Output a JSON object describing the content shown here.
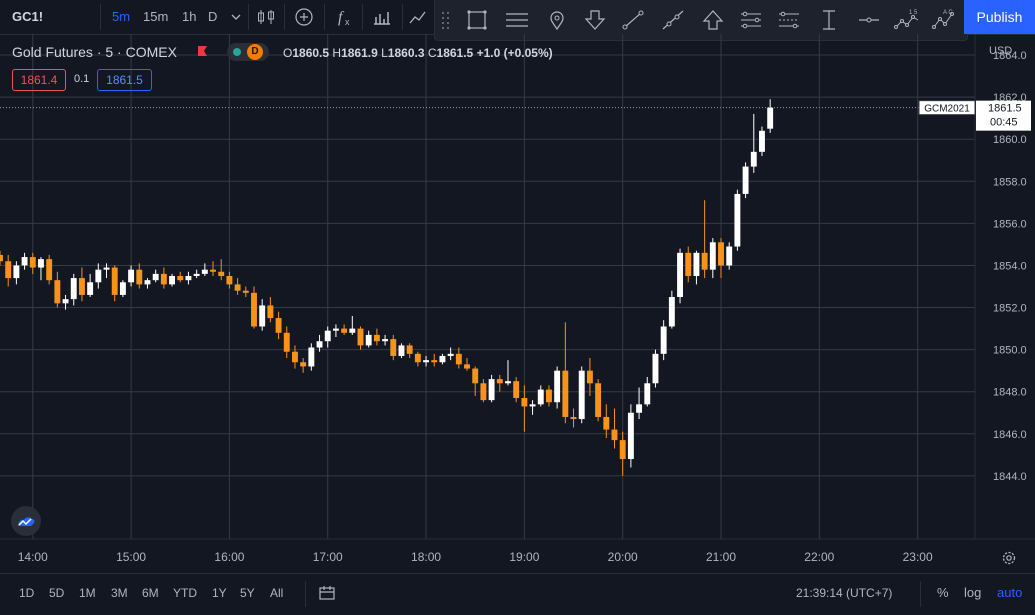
{
  "toolbar": {
    "symbol": "GC1!",
    "intervals": [
      "5m",
      "15m",
      "1h",
      "D"
    ],
    "active_interval": "5m",
    "publish_label": "Publish",
    "icons": [
      "chevron-down-icon",
      "candles-icon",
      "add-compare-icon",
      "indicators-icon",
      "financials-icon"
    ],
    "drawing_icons": [
      "rectangle-icon",
      "horizontal-lines-icon",
      "pin-icon",
      "arrow-down-icon",
      "trend-line-icon",
      "ray-icon",
      "arrow-up-icon",
      "parallel-channel-icon",
      "regression-icon",
      "price-range-icon",
      "horizontal-ray-icon",
      "xabcd-pattern-icon",
      "abcd-pattern-icon"
    ]
  },
  "legend": {
    "title": "Gold Futures · 5 · COMEX",
    "badge_d": "D",
    "open_label": "O",
    "open": "1860.5",
    "high_label": "H",
    "high": "1861.9",
    "low_label": "L",
    "low": "1860.3",
    "close_label": "C",
    "close": "1861.5",
    "change": "+1.0 (+0.05%)",
    "bid": "1861.4",
    "spread": "0.1",
    "ask": "1861.5"
  },
  "price_scale": {
    "contract_label": "GCM2021",
    "last_price": "1861.5",
    "countdown": "00:45",
    "currency": "USD"
  },
  "bottom": {
    "ranges": [
      "1D",
      "5D",
      "1M",
      "3M",
      "6M",
      "YTD",
      "1Y",
      "5Y",
      "All"
    ],
    "clock": "21:39:14 (UTC+7)",
    "percent_label": "%",
    "log_label": "log",
    "auto_label": "auto"
  },
  "colors": {
    "up": "#ffffff",
    "down": "#f7931a",
    "background": "#131722",
    "grid": "#363a45",
    "accent": "#2962ff"
  },
  "chart_data": {
    "type": "candlestick",
    "title": "Gold Futures · 5 · COMEX",
    "xlabel": "",
    "ylabel": "",
    "x_ticks": [
      "14:00",
      "15:00",
      "16:00",
      "17:00",
      "18:00",
      "19:00",
      "20:00",
      "21:00",
      "22:00",
      "23:00"
    ],
    "y_ticks": [
      1844.0,
      1846.0,
      1848.0,
      1850.0,
      1852.0,
      1854.0,
      1856.0,
      1858.0,
      1860.0,
      1862.0,
      1864.0
    ],
    "ylim": [
      1841.0,
      1865.0
    ],
    "xlim": [
      "13:40",
      "23:35"
    ],
    "interval_minutes": 5,
    "first_bar": "13:40",
    "grid": true,
    "last_price_line": 1861.5,
    "ohlc": [
      [
        1854.5,
        1854.7,
        1854.0,
        1854.2
      ],
      [
        1854.2,
        1854.5,
        1853.0,
        1853.4
      ],
      [
        1853.4,
        1854.2,
        1853.1,
        1854.0
      ],
      [
        1854.0,
        1854.6,
        1853.8,
        1854.4
      ],
      [
        1854.4,
        1854.6,
        1853.6,
        1853.9
      ],
      [
        1853.9,
        1854.4,
        1853.3,
        1854.3
      ],
      [
        1854.3,
        1854.5,
        1853.1,
        1853.3
      ],
      [
        1853.3,
        1853.7,
        1852.0,
        1852.2
      ],
      [
        1852.2,
        1852.6,
        1851.9,
        1852.4
      ],
      [
        1852.4,
        1853.6,
        1852.1,
        1853.4
      ],
      [
        1853.4,
        1853.9,
        1852.3,
        1852.6
      ],
      [
        1852.6,
        1853.6,
        1852.5,
        1853.2
      ],
      [
        1853.2,
        1854.1,
        1852.9,
        1853.8
      ],
      [
        1853.8,
        1854.1,
        1853.4,
        1853.9
      ],
      [
        1853.9,
        1854.0,
        1852.3,
        1852.6
      ],
      [
        1852.6,
        1853.3,
        1852.5,
        1853.2
      ],
      [
        1853.2,
        1854.0,
        1853.0,
        1853.8
      ],
      [
        1853.8,
        1854.1,
        1852.9,
        1853.1
      ],
      [
        1853.1,
        1853.4,
        1852.9,
        1853.3
      ],
      [
        1853.3,
        1853.8,
        1853.2,
        1853.6
      ],
      [
        1853.6,
        1853.9,
        1852.9,
        1853.1
      ],
      [
        1853.1,
        1853.6,
        1853.0,
        1853.5
      ],
      [
        1853.5,
        1853.7,
        1853.2,
        1853.3
      ],
      [
        1853.3,
        1853.7,
        1853.1,
        1853.5
      ],
      [
        1853.5,
        1853.8,
        1853.4,
        1853.6
      ],
      [
        1853.6,
        1854.1,
        1853.5,
        1853.8
      ],
      [
        1853.8,
        1854.2,
        1853.5,
        1853.7
      ],
      [
        1853.7,
        1854.3,
        1853.3,
        1853.5
      ],
      [
        1853.5,
        1853.7,
        1852.9,
        1853.1
      ],
      [
        1853.1,
        1853.4,
        1852.6,
        1852.8
      ],
      [
        1852.8,
        1853.0,
        1852.5,
        1852.7
      ],
      [
        1852.7,
        1853.0,
        1851.0,
        1851.1
      ],
      [
        1851.1,
        1852.4,
        1850.9,
        1852.1
      ],
      [
        1852.1,
        1852.5,
        1851.3,
        1851.5
      ],
      [
        1851.5,
        1851.8,
        1850.5,
        1850.8
      ],
      [
        1850.8,
        1851.1,
        1849.6,
        1849.9
      ],
      [
        1849.9,
        1850.2,
        1849.1,
        1849.4
      ],
      [
        1849.4,
        1849.6,
        1848.9,
        1849.2
      ],
      [
        1849.2,
        1850.3,
        1849.0,
        1850.1
      ],
      [
        1850.1,
        1850.7,
        1849.9,
        1850.4
      ],
      [
        1850.4,
        1851.1,
        1850.1,
        1850.9
      ],
      [
        1850.9,
        1851.2,
        1850.6,
        1851.0
      ],
      [
        1851.0,
        1851.2,
        1850.7,
        1850.8
      ],
      [
        1850.8,
        1851.6,
        1850.7,
        1851.0
      ],
      [
        1851.0,
        1851.1,
        1850.0,
        1850.2
      ],
      [
        1850.2,
        1850.9,
        1850.1,
        1850.7
      ],
      [
        1850.7,
        1851.0,
        1850.2,
        1850.4
      ],
      [
        1850.4,
        1850.7,
        1850.2,
        1850.5
      ],
      [
        1850.5,
        1850.7,
        1849.5,
        1849.7
      ],
      [
        1849.7,
        1850.3,
        1849.6,
        1850.2
      ],
      [
        1850.2,
        1850.3,
        1849.6,
        1849.8
      ],
      [
        1849.8,
        1849.9,
        1849.2,
        1849.4
      ],
      [
        1849.4,
        1849.7,
        1849.2,
        1849.5
      ],
      [
        1849.5,
        1849.8,
        1849.2,
        1849.4
      ],
      [
        1849.4,
        1849.8,
        1849.3,
        1849.7
      ],
      [
        1849.7,
        1850.1,
        1849.5,
        1849.8
      ],
      [
        1849.8,
        1850.1,
        1849.1,
        1849.3
      ],
      [
        1849.3,
        1849.6,
        1849.0,
        1849.1
      ],
      [
        1849.1,
        1849.2,
        1847.8,
        1848.4
      ],
      [
        1848.4,
        1848.6,
        1847.5,
        1847.6
      ],
      [
        1847.6,
        1848.8,
        1847.5,
        1848.6
      ],
      [
        1848.6,
        1848.8,
        1848.0,
        1848.4
      ],
      [
        1848.4,
        1849.5,
        1848.3,
        1848.5
      ],
      [
        1848.5,
        1848.7,
        1847.5,
        1847.7
      ],
      [
        1847.7,
        1848.3,
        1846.1,
        1847.3
      ],
      [
        1847.3,
        1847.6,
        1846.9,
        1847.4
      ],
      [
        1847.4,
        1848.3,
        1847.3,
        1848.1
      ],
      [
        1848.1,
        1848.3,
        1847.3,
        1847.5
      ],
      [
        1847.5,
        1849.2,
        1847.2,
        1849.0
      ],
      [
        1849.0,
        1851.3,
        1846.5,
        1846.8
      ],
      [
        1846.8,
        1847.2,
        1846.3,
        1846.7
      ],
      [
        1846.7,
        1849.2,
        1846.5,
        1849.0
      ],
      [
        1849.0,
        1849.6,
        1847.8,
        1848.4
      ],
      [
        1848.4,
        1848.6,
        1846.6,
        1846.8
      ],
      [
        1846.8,
        1847.4,
        1845.8,
        1846.2
      ],
      [
        1846.2,
        1847.2,
        1845.3,
        1845.7
      ],
      [
        1845.7,
        1846.1,
        1844.0,
        1844.8
      ],
      [
        1844.8,
        1847.4,
        1844.4,
        1847.0
      ],
      [
        1847.0,
        1848.2,
        1846.7,
        1847.4
      ],
      [
        1847.4,
        1848.7,
        1847.3,
        1848.4
      ],
      [
        1848.4,
        1850.0,
        1848.2,
        1849.8
      ],
      [
        1849.8,
        1851.4,
        1849.5,
        1851.1
      ],
      [
        1851.1,
        1852.8,
        1851.0,
        1852.5
      ],
      [
        1852.5,
        1854.8,
        1852.2,
        1854.6
      ],
      [
        1854.6,
        1854.9,
        1853.2,
        1853.5
      ],
      [
        1853.5,
        1854.7,
        1853.1,
        1854.6
      ],
      [
        1854.6,
        1857.1,
        1853.4,
        1853.8
      ],
      [
        1853.8,
        1855.3,
        1853.4,
        1855.1
      ],
      [
        1855.1,
        1855.3,
        1853.4,
        1854.0
      ],
      [
        1854.0,
        1855.1,
        1853.8,
        1854.9
      ],
      [
        1854.9,
        1857.6,
        1854.7,
        1857.4
      ],
      [
        1857.4,
        1858.9,
        1857.2,
        1858.7
      ],
      [
        1858.7,
        1861.2,
        1858.4,
        1859.4
      ],
      [
        1859.4,
        1860.6,
        1859.2,
        1860.4
      ],
      [
        1860.5,
        1861.9,
        1860.3,
        1861.5
      ]
    ]
  }
}
